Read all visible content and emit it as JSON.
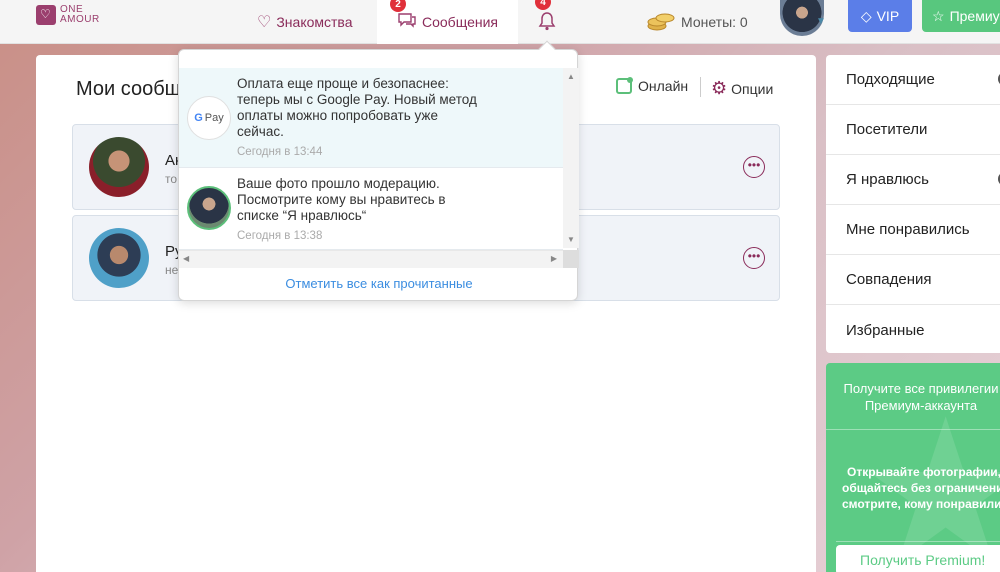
{
  "header": {
    "logo_line1": "ONE",
    "logo_line2": "AMOUR",
    "nav_dating": "Знакомства",
    "nav_messages": "Сообщения",
    "messages_badge": "2",
    "notifications_badge": "4",
    "coins_label": "Монеты: 0",
    "vip_label": "VIP",
    "premium_label": "Премиум"
  },
  "main": {
    "title": "Мои сообщения",
    "online_label": "Онлайн",
    "options_label": "Опции",
    "conversations": [
      {
        "name": "Ан",
        "preview": "то"
      },
      {
        "name": "Ру",
        "preview": "не"
      }
    ]
  },
  "notifications": {
    "items": [
      {
        "icon": "google-pay-icon",
        "icon_text_g": "G",
        "icon_text_pay": "Pay",
        "text": "Оплата еще проще и безопаснее: теперь мы с Google Pay. Новый метод оплаты можно попробовать уже сейчас.",
        "time": "Сегодня в 13:44"
      },
      {
        "icon": "user-photo-icon",
        "text": "Ваше фото прошло модерацию. Посмотрите кому вы нравитесь в списке “Я нравлюсь“",
        "time": "Сегодня в 13:38"
      }
    ],
    "mark_all_read": "Отметить все как прочитанные"
  },
  "sidebar": {
    "items": [
      {
        "label": "Подходящие"
      },
      {
        "label": "Посетители"
      },
      {
        "label": "Я нравлюсь"
      },
      {
        "label": "Мне понравились"
      },
      {
        "label": "Совпадения"
      },
      {
        "label": "Избранные"
      }
    ]
  },
  "promo": {
    "title_line1": "Получите все привилегии",
    "title_line2": "Премиум-аккаунта",
    "text_line1": "Открывайте фотографии,",
    "text_line2": "общайтесь без ограничений,",
    "text_line3": "смотрите, кому понравились",
    "button": "Получить Premium!"
  },
  "colors": {
    "brand": "#8a2b5a",
    "vip": "#5b7ee8",
    "premium": "#58c77e",
    "link": "#3b8de0"
  }
}
